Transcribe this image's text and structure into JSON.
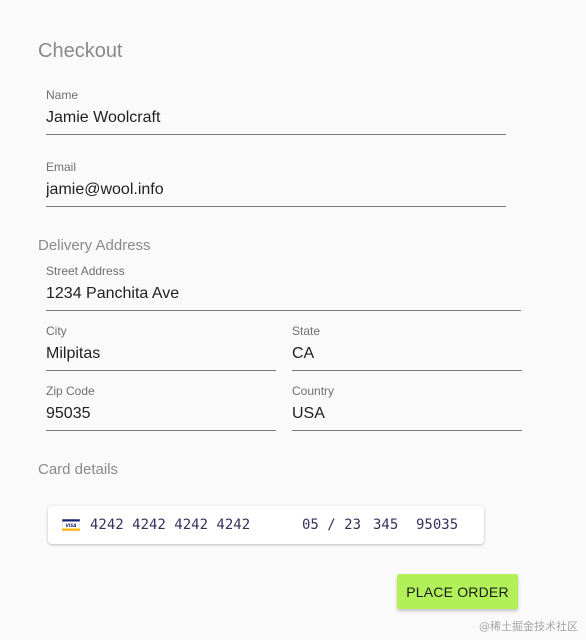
{
  "checkout": {
    "title": "Checkout",
    "name": {
      "label": "Name",
      "value": "Jamie Woolcraft"
    },
    "email": {
      "label": "Email",
      "value": "jamie@wool.info"
    }
  },
  "delivery": {
    "title": "Delivery Address",
    "street": {
      "label": "Street Address",
      "value": "1234 Panchita Ave"
    },
    "city": {
      "label": "City",
      "value": "Milpitas"
    },
    "state": {
      "label": "State",
      "value": "CA"
    },
    "zip": {
      "label": "Zip Code",
      "value": "95035"
    },
    "country": {
      "label": "Country",
      "value": "USA"
    }
  },
  "card": {
    "title": "Card details",
    "brand_icon": "visa-card-icon",
    "brand_text": "VISA",
    "number": "4242 4242 4242 4242",
    "expiry": "05 / 23",
    "cvc": "345",
    "zip": "95035"
  },
  "actions": {
    "place_order": "PLACE ORDER"
  },
  "watermark": "@稀土掘金技术社区",
  "colors": {
    "accent": "#b2f05a",
    "section_title": "#8a8a8a",
    "underline": "#7a7a7a"
  }
}
